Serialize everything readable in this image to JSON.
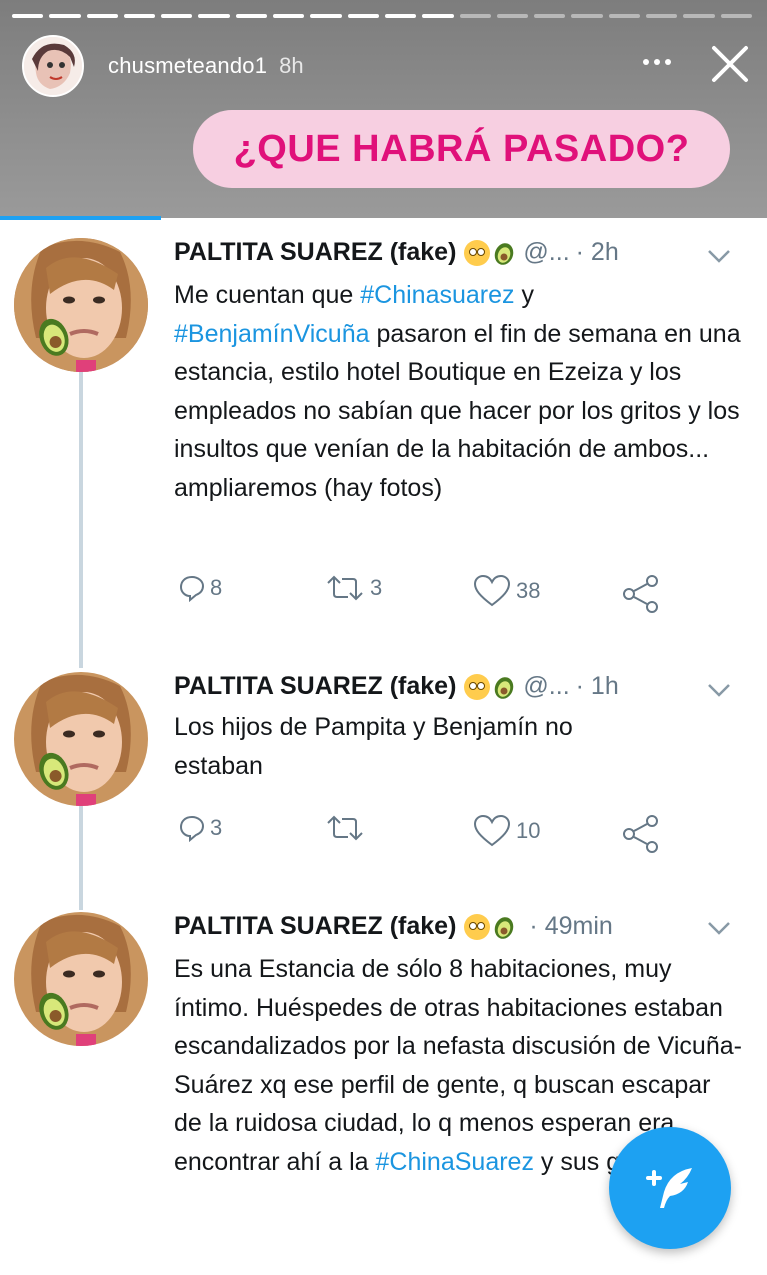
{
  "story": {
    "username": "chusmeteando1",
    "time": "8h",
    "sticker_text": "¿QUE HABRÁ PASADO?"
  },
  "tweets": [
    {
      "name": "PALTITA SUAREZ (fake)",
      "handle": "@...",
      "time": "· 2h",
      "text_parts": [
        {
          "t": "Me cuentan que ",
          "h": false
        },
        {
          "t": "#Chinasuarez",
          "h": true
        },
        {
          "t": " y ",
          "h": false
        },
        {
          "t": "#BenjamínVicuña",
          "h": true
        },
        {
          "t": " pasaron el fin de semana en una estancia, estilo hotel Boutique en Ezeiza y los empleados no sabían que hacer por los gritos y los insultos que venían de la habitación de ambos... ampliaremos (hay fotos)",
          "h": false
        }
      ],
      "replies": "8",
      "retweets": "3",
      "likes": "38"
    },
    {
      "name": "PALTITA SUAREZ (fake)",
      "handle": "@...",
      "time": "· 1h",
      "text_parts": [
        {
          "t": "Los hijos de Pampita y Benjamín no estaban",
          "h": false
        }
      ],
      "replies": "3",
      "retweets": "",
      "likes": "10"
    },
    {
      "name": "PALTITA SUAREZ (fake)",
      "handle": "",
      "time": "· 49min",
      "text_parts": [
        {
          "t": "Es una Estancia de sólo 8 habitaciones, muy íntimo. Huéspedes de otras habitaciones estaban escandalizados por la nefasta discusión de Vicuña-Suárez xq ese perfil de gente, q buscan escapar de la ruidosa ciudad, lo q menos espe",
          "h": false
        },
        {
          "t": "ran era encontrar ahí a la ",
          "h": false
        },
        {
          "t": "#ChinaSuarez",
          "h": true
        },
        {
          "t": " y sus gritos.",
          "h": false
        }
      ]
    }
  ],
  "colors": {
    "accent": "#1da1f2",
    "sticker_bg": "#f7cfe1",
    "sticker_text": "#e0117a",
    "hashtag": "#1b95e0"
  }
}
